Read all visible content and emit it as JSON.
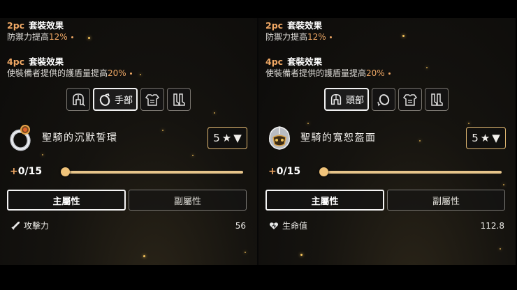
{
  "panels": [
    {
      "set_2pc": {
        "pc": "2pc",
        "title": "套裝效果",
        "desc_prefix": "防禦力提高",
        "desc_value": "12%"
      },
      "set_4pc": {
        "pc": "4pc",
        "title": "套裝效果",
        "desc_prefix": "使裝備者提供的護盾量提高",
        "desc_value": "20%"
      },
      "slots": [
        {
          "icon": "helmet-icon",
          "label": ""
        },
        {
          "icon": "ring-icon",
          "label": "手部",
          "active": true
        },
        {
          "icon": "chest-armor-icon",
          "label": ""
        },
        {
          "icon": "boots-icon",
          "label": ""
        }
      ],
      "item": {
        "icon": "ring-icon",
        "name": "聖騎的沉默誓環"
      },
      "stars": {
        "value": "5",
        "star": "★",
        "arrow": "▼"
      },
      "level": {
        "plus": "+",
        "text": "0/15",
        "progress": 0
      },
      "tabs": {
        "primary": "主屬性",
        "secondary": "副屬性"
      },
      "stat": {
        "icon": "sword-icon",
        "name": "攻擊力",
        "value": "56"
      }
    },
    {
      "set_2pc": {
        "pc": "2pc",
        "title": "套裝效果",
        "desc_prefix": "防禦力提高",
        "desc_value": "12%"
      },
      "set_4pc": {
        "pc": "4pc",
        "title": "套裝效果",
        "desc_prefix": "使裝備者提供的護盾量提高",
        "desc_value": "20%"
      },
      "slots": [
        {
          "icon": "helmet-icon",
          "label": "頭部",
          "active": true
        },
        {
          "icon": "ring-icon",
          "label": ""
        },
        {
          "icon": "chest-armor-icon",
          "label": ""
        },
        {
          "icon": "boots-icon",
          "label": ""
        }
      ],
      "item": {
        "icon": "helmet-icon",
        "name": "聖騎的寬恕盔面"
      },
      "stars": {
        "value": "5",
        "star": "★",
        "arrow": "▼"
      },
      "level": {
        "plus": "+",
        "text": "0/15",
        "progress": 0
      },
      "tabs": {
        "primary": "主屬性",
        "secondary": "副屬性"
      },
      "stat": {
        "icon": "heart-icon",
        "name": "生命值",
        "value": "112.8"
      }
    }
  ],
  "colors": {
    "accent": "#f0a865",
    "gold_border": "#e0b872",
    "slider": "#e6c48a"
  }
}
